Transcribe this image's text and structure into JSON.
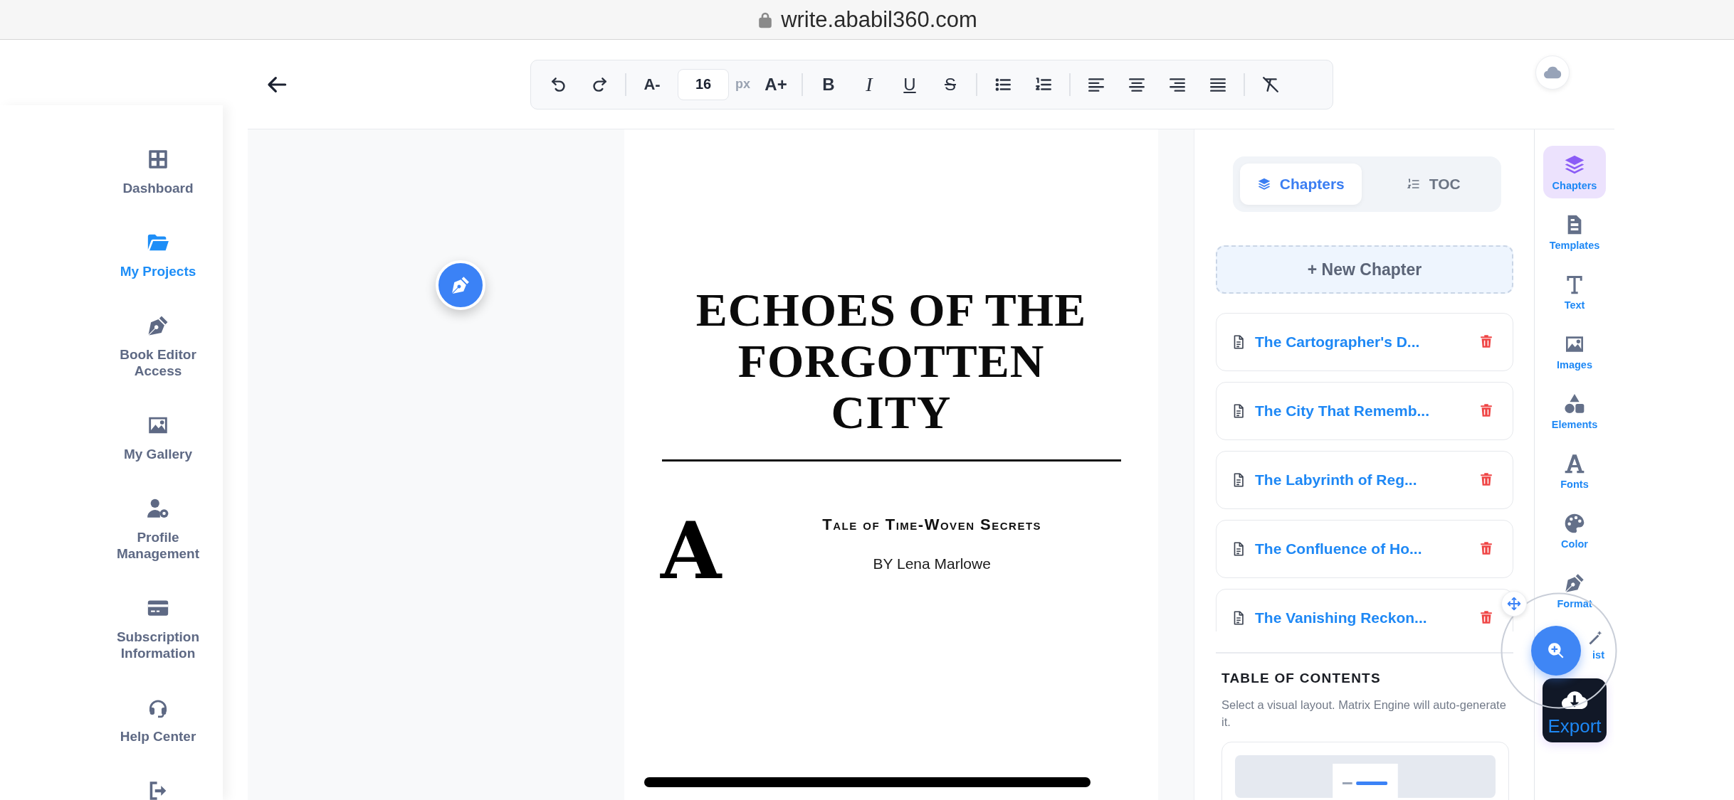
{
  "browser": {
    "url": "write.ababil360.com"
  },
  "sidebar": {
    "items": [
      {
        "kind": "grid",
        "label": "Dashboard",
        "selected": false
      },
      {
        "kind": "folder",
        "label": "My Projects",
        "selected": true
      },
      {
        "kind": "pen",
        "label": "Book Editor Access",
        "selected": false
      },
      {
        "kind": "image",
        "label": "My Gallery",
        "selected": false
      },
      {
        "kind": "user-gear",
        "label": "Profile Management",
        "selected": false
      },
      {
        "kind": "card",
        "label": "Subscription Information",
        "selected": false
      },
      {
        "kind": "headset",
        "label": "Help Center",
        "selected": false
      },
      {
        "kind": "logout",
        "selected": false
      }
    ]
  },
  "toolbar": {
    "groups": [
      [
        {
          "kind": "undo"
        },
        {
          "kind": "redo"
        }
      ],
      [
        {
          "kind": "decrease",
          "label": "A-"
        },
        {
          "kind": "size",
          "value": "16",
          "unit": "px"
        },
        {
          "kind": "increase",
          "label": "A+"
        }
      ],
      [
        {
          "kind": "bold",
          "label": "B"
        },
        {
          "kind": "italic",
          "label": "I"
        },
        {
          "kind": "underline",
          "label": "U"
        },
        {
          "kind": "strike",
          "label": "S"
        }
      ],
      [
        {
          "kind": "bullets"
        },
        {
          "kind": "numbers"
        }
      ],
      [
        {
          "kind": "align-left"
        },
        {
          "kind": "align-center"
        },
        {
          "kind": "align-right"
        },
        {
          "kind": "justify"
        }
      ],
      [
        {
          "kind": "clear"
        }
      ]
    ]
  },
  "page": {
    "title_lines": [
      "ECHOES OF THE",
      "FORGOTTEN",
      "CITY"
    ],
    "drop_cap": "A",
    "subtitle": "Tale of Time-Woven Secrets",
    "byline": "BY Lena Marlowe"
  },
  "panel": {
    "tabs": [
      {
        "kind": "layers",
        "label": "Chapters",
        "selected": true
      },
      {
        "kind": "numbers",
        "label": "TOC",
        "selected": false
      }
    ],
    "new_chapter": "+ New Chapter",
    "chapters": [
      "The Cartographer's D...",
      "The City That Rememb...",
      "The Labyrinth of Reg...",
      "The Confluence of Ho...",
      "The Vanishing Reckon..."
    ],
    "toc": {
      "heading": "TABLE OF CONTENTS",
      "description": "Select a visual layout. Matrix Engine will auto-generate it."
    }
  },
  "rail": {
    "items": [
      {
        "kind": "layers",
        "label": "Chapters",
        "selected": true
      },
      {
        "kind": "template",
        "label": "Templates",
        "selected": false
      },
      {
        "kind": "text",
        "label": "Text",
        "selected": false
      },
      {
        "kind": "image",
        "label": "Images",
        "selected": false
      },
      {
        "kind": "shapes",
        "label": "Elements",
        "selected": false
      },
      {
        "kind": "font",
        "label": "Fonts",
        "selected": false
      },
      {
        "kind": "palette",
        "label": "Color",
        "selected": false
      },
      {
        "kind": "pen",
        "label": "Format",
        "selected": false
      },
      {
        "kind": "wand",
        "label": "ist",
        "selected": false
      }
    ]
  },
  "export": {
    "label": "Export"
  }
}
